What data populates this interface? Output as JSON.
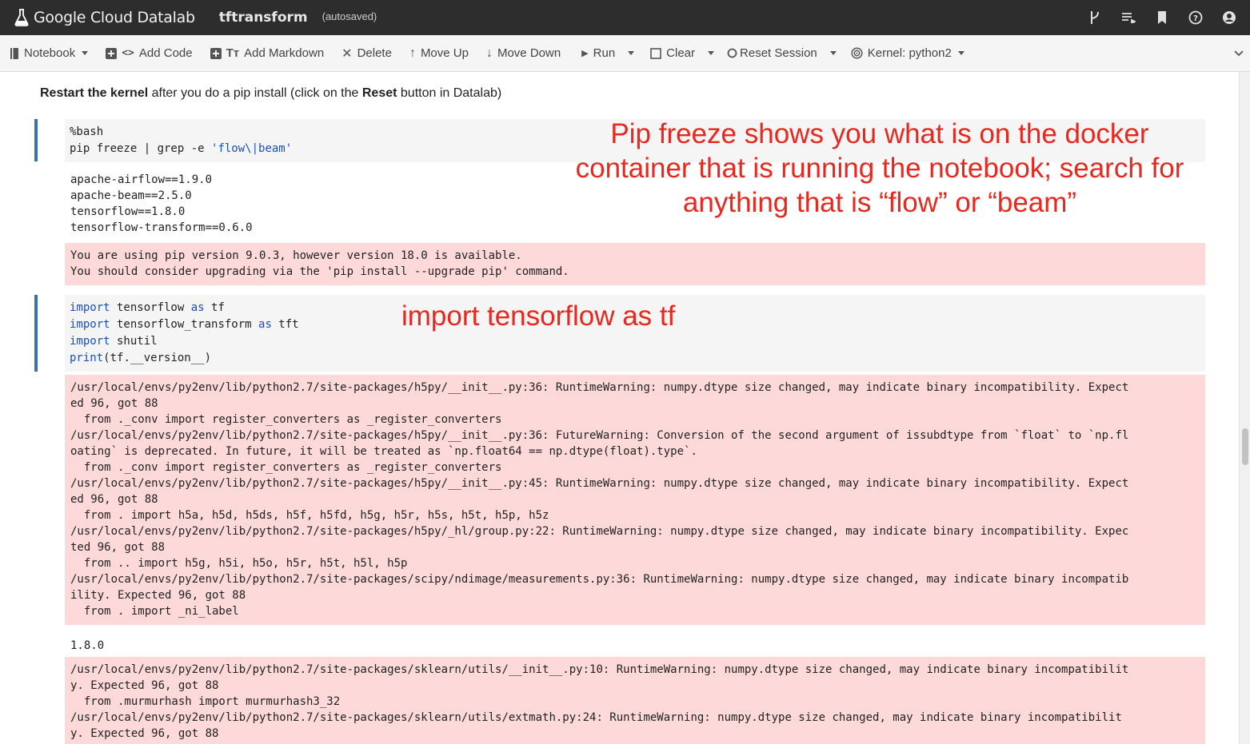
{
  "app": {
    "brand": "Google Cloud Datalab",
    "notebook_title": "tftransform",
    "status": "(autosaved)",
    "header_icons": [
      "branch-icon",
      "list-icon",
      "bookmark-icon",
      "help-icon",
      "account-icon"
    ]
  },
  "toolbar": {
    "notebook": "Notebook",
    "add_code": "Add Code",
    "add_markdown": "Add Markdown",
    "delete": "Delete",
    "move_up": "Move Up",
    "move_down": "Move Down",
    "run": "Run",
    "clear": "Clear",
    "reset_session": "Reset Session",
    "kernel": "Kernel: python2"
  },
  "markdown": {
    "bold1": "Restart the kernel",
    "text1": " after you do a pip install (click on the ",
    "bold2": "Reset",
    "text2": " button in Datalab)"
  },
  "cell1": {
    "line1": "%bash",
    "line2_pre": "pip freeze | grep -e ",
    "line2_str": "'flow\\|beam'",
    "output": "apache-airflow==1.9.0\napache-beam==2.5.0\ntensorflow==1.8.0\ntensorflow-transform==0.6.0",
    "stderr": "You are using pip version 9.0.3, however version 18.0 is available.\nYou should consider upgrading via the 'pip install --upgrade pip' command."
  },
  "cell2": {
    "kw_import": "import",
    "kw_as": "as",
    "kw_print": "print",
    "l1_mod": " tensorflow ",
    "l1_alias": " tf",
    "l2_mod": " tensorflow_transform ",
    "l2_alias": " tft",
    "l3_mod": " shutil",
    "l4_rest": "(tf.__version__)",
    "stderr1": "/usr/local/envs/py2env/lib/python2.7/site-packages/h5py/__init__.py:36: RuntimeWarning: numpy.dtype size changed, may indicate binary incompatibility. Expect\ned 96, got 88\n  from ._conv import register_converters as _register_converters\n/usr/local/envs/py2env/lib/python2.7/site-packages/h5py/__init__.py:36: FutureWarning: Conversion of the second argument of issubdtype from `float` to `np.fl\noating` is deprecated. In future, it will be treated as `np.float64 == np.dtype(float).type`.\n  from ._conv import register_converters as _register_converters\n/usr/local/envs/py2env/lib/python2.7/site-packages/h5py/__init__.py:45: RuntimeWarning: numpy.dtype size changed, may indicate binary incompatibility. Expect\ned 96, got 88\n  from . import h5a, h5d, h5ds, h5f, h5fd, h5g, h5r, h5s, h5t, h5p, h5z\n/usr/local/envs/py2env/lib/python2.7/site-packages/h5py/_hl/group.py:22: RuntimeWarning: numpy.dtype size changed, may indicate binary incompatibility. Expec\nted 96, got 88\n  from .. import h5g, h5i, h5o, h5r, h5t, h5l, h5p\n/usr/local/envs/py2env/lib/python2.7/site-packages/scipy/ndimage/measurements.py:36: RuntimeWarning: numpy.dtype size changed, may indicate binary incompatib\nility. Expected 96, got 88\n  from . import _ni_label",
    "version_output": "1.8.0",
    "stderr2": "/usr/local/envs/py2env/lib/python2.7/site-packages/sklearn/utils/__init__.py:10: RuntimeWarning: numpy.dtype size changed, may indicate binary incompatibilit\ny. Expected 96, got 88\n  from .murmurhash import murmurhash3_32\n/usr/local/envs/py2env/lib/python2.7/site-packages/sklearn/utils/extmath.py:24: RuntimeWarning: numpy.dtype size changed, may indicate binary incompatibilit\ny. Expected 96, got 88"
  },
  "annotations": {
    "pip_freeze": "Pip freeze shows you what is on the docker container that is running the notebook; search for anything that is “flow” or “beam”",
    "import_tf": "import tensorflow as tf"
  },
  "colors": {
    "appbar": "#2d2d2d",
    "annotation": "#e8281e",
    "stderr_bg": "#fdd9d9",
    "cell_selected": "#3a6fb0",
    "keyword": "#1a4ec0"
  }
}
